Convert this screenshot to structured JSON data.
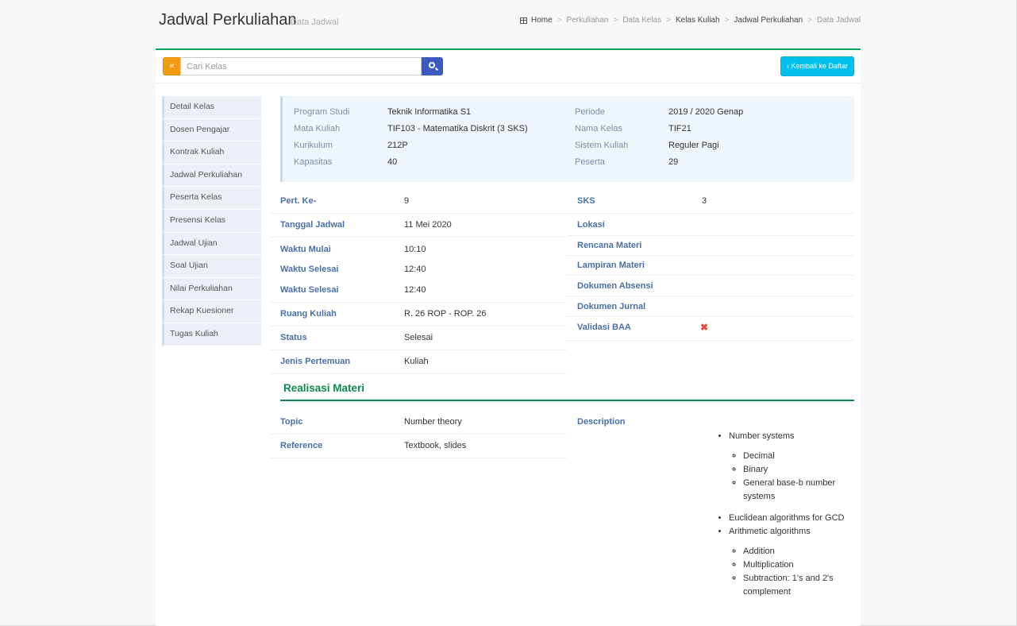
{
  "header": {
    "title": "Jadwal Perkuliahan",
    "subtitle": "Data Jadwal",
    "breadcrumb": [
      "Home",
      "Perkuliahan",
      "Data Kelas",
      "Kelas Kuliah",
      "Jadwal Perkuliahan",
      "Data Jadwal"
    ]
  },
  "toolbar": {
    "prev_label": "«",
    "search_placeholder": "Cari Kelas",
    "back_label": "Kembali ke Daftar",
    "back_icon": "‹"
  },
  "sidebar": {
    "items": [
      {
        "label": "Detail Kelas"
      },
      {
        "label": "Dosen Pengajar"
      },
      {
        "label": "Kontrak Kuliah"
      },
      {
        "label": "Jadwal Perkuliahan"
      },
      {
        "label": "Peserta Kelas"
      },
      {
        "label": "Presensi Kelas"
      },
      {
        "label": "Jadwal Ujian"
      },
      {
        "label": "Soal Ujian"
      },
      {
        "label": "Nilai Perkuliahan"
      },
      {
        "label": "Rekap Kuesioner"
      },
      {
        "label": "Tugas Kuliah"
      }
    ]
  },
  "info": {
    "program_studi_label": "Program Studi",
    "program_studi": "Teknik Informatika S1",
    "mata_kuliah_label": "Mata Kuliah",
    "mata_kuliah": "TIF103 - Matematika Diskrit (3 SKS)",
    "kurikulum_label": "Kurikulum",
    "kurikulum": "212P",
    "kapasitas_label": "Kapasitas",
    "kapasitas": "40",
    "periode_label": "Periode",
    "periode": "2019 / 2020 Genap",
    "nama_kelas_label": "Nama Kelas",
    "nama_kelas": "TIF21",
    "sistem_kuliah_label": "Sistem Kuliah",
    "sistem_kuliah": "Reguler Pagi",
    "peserta_label": "Peserta",
    "peserta": "29"
  },
  "detail_left": [
    {
      "label": "Pert. Ke-",
      "value": "9"
    },
    {
      "label": "Tanggal Jadwal",
      "value": "11 Mei 2020"
    },
    {
      "label": "Waktu Mulai",
      "value": "10:10"
    },
    {
      "label": "Waktu Selesai",
      "value": "12:40"
    },
    {
      "label": "Waktu Selesai",
      "value": "12:40"
    },
    {
      "label": "Ruang Kuliah",
      "value": "R. 26 ROP - ROP. 26"
    },
    {
      "label": "Status",
      "value": "Selesai"
    },
    {
      "label": "Jenis Pertemuan",
      "value": "Kuliah"
    }
  ],
  "detail_right": [
    {
      "label": "SKS",
      "value": "3"
    },
    {
      "label": "Lokasi",
      "value": ""
    },
    {
      "label": "Rencana Materi",
      "value": ""
    },
    {
      "label": "Lampiran Materi",
      "value": ""
    },
    {
      "label": "Dokumen Absensi",
      "value": ""
    },
    {
      "label": "Dokumen Jurnal",
      "value": ""
    },
    {
      "label": "Validasi BAA",
      "value": "✖"
    }
  ],
  "realisasi": {
    "title": "Realisasi Materi",
    "topic_label": "Topic",
    "topic": "Number theory",
    "reference_label": "Reference",
    "reference": "Textbook, slides",
    "description_label": "Description",
    "description": {
      "number_systems": "Number systems",
      "decimal": "Decimal",
      "binary": "Binary",
      "general_base": "General base-b number systems",
      "euclidean": "Euclidean algorithms for GCD",
      "arithmetic": "Arithmetic algorithms",
      "addition": "Addition",
      "multiplication": "Multiplication",
      "subtraction": "Subtraction: 1's and 2's complement"
    }
  },
  "colors": {
    "accent_green": "#00a65a",
    "orange": "#f39c12",
    "blue": "#3c5abf",
    "cyan": "#00c0ef",
    "red": "#e74c3c"
  }
}
